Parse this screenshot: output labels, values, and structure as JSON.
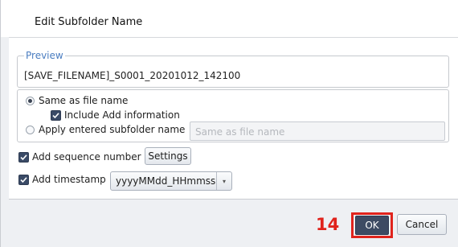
{
  "dialog": {
    "title": "Edit Subfolder Name"
  },
  "preview": {
    "legend": "Preview",
    "text": "[SAVE_FILENAME]_S0001_20201012_142100"
  },
  "subfolder": {
    "same_as_file_name_label": "Same as file name",
    "same_as_file_name_selected": true,
    "include_add_info_label": "Include Add information",
    "include_add_info_checked": true,
    "apply_entered_label": "Apply entered subfolder name",
    "apply_entered_selected": false,
    "subfolder_input_placeholder": "Same as file name"
  },
  "options": {
    "add_sequence_label": "Add sequence number",
    "add_sequence_checked": true,
    "settings_button": "Settings",
    "add_timestamp_label": "Add timestamp",
    "add_timestamp_checked": true,
    "timestamp_format": "yyyyMMdd_HHmmss"
  },
  "footer": {
    "step_number": "14",
    "ok_label": "OK",
    "cancel_label": "Cancel"
  },
  "colors": {
    "accent": "#3d4b63",
    "annotation": "#e0231c",
    "legend": "#4a7dc0"
  }
}
